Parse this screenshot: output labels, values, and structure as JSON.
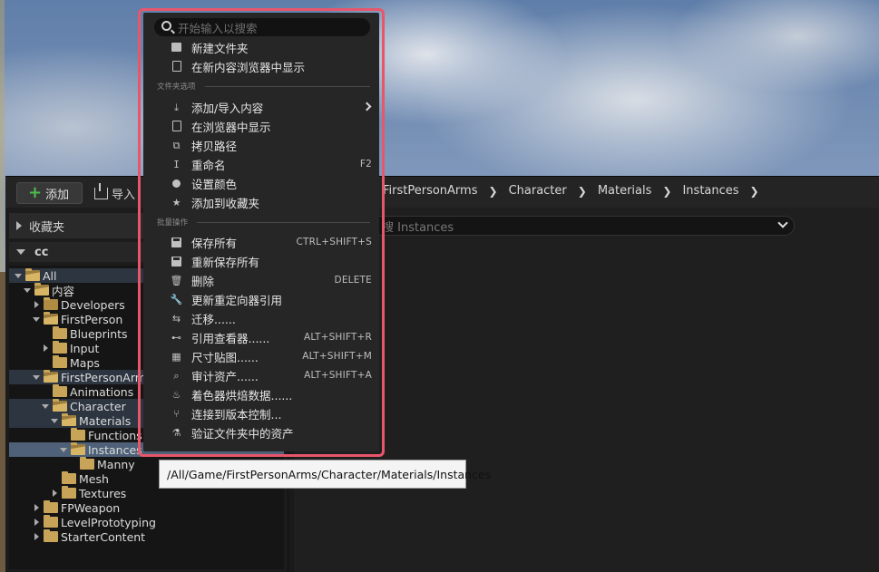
{
  "toolbar": {
    "add_label": "添加",
    "import_label": "导入"
  },
  "breadcrumb": [
    "FirstPersonArms",
    "Character",
    "Materials",
    "Instances"
  ],
  "search": {
    "placeholder": "搜 Instances"
  },
  "favorites": {
    "label": "收藏夹"
  },
  "collection": {
    "label": "cc"
  },
  "tree": [
    {
      "label": "All",
      "indent": 0,
      "arrow": "down",
      "folder": "open",
      "state": "hl"
    },
    {
      "label": "内容",
      "indent": 1,
      "arrow": "down",
      "folder": "open",
      "state": ""
    },
    {
      "label": "Developers",
      "indent": 2,
      "arrow": "right",
      "folder": "dev",
      "state": ""
    },
    {
      "label": "FirstPerson",
      "indent": 2,
      "arrow": "down",
      "folder": "open",
      "state": ""
    },
    {
      "label": "Blueprints",
      "indent": 3,
      "arrow": "none",
      "folder": "closed",
      "state": ""
    },
    {
      "label": "Input",
      "indent": 3,
      "arrow": "right",
      "folder": "closed",
      "state": ""
    },
    {
      "label": "Maps",
      "indent": 3,
      "arrow": "none",
      "folder": "closed",
      "state": ""
    },
    {
      "label": "FirstPersonArms",
      "indent": 2,
      "arrow": "down",
      "folder": "open",
      "state": "hl"
    },
    {
      "label": "Animations",
      "indent": 3,
      "arrow": "none",
      "folder": "closed",
      "state": ""
    },
    {
      "label": "Character",
      "indent": 3,
      "arrow": "down",
      "folder": "open",
      "state": "hl"
    },
    {
      "label": "Materials",
      "indent": 4,
      "arrow": "down",
      "folder": "open",
      "state": "hl"
    },
    {
      "label": "Functions",
      "indent": 5,
      "arrow": "none",
      "folder": "closed",
      "state": ""
    },
    {
      "label": "Instances",
      "indent": 5,
      "arrow": "down",
      "folder": "open",
      "state": "sel"
    },
    {
      "label": "Manny",
      "indent": 6,
      "arrow": "none",
      "folder": "closed",
      "state": ""
    },
    {
      "label": "Mesh",
      "indent": 4,
      "arrow": "none",
      "folder": "closed",
      "state": ""
    },
    {
      "label": "Textures",
      "indent": 4,
      "arrow": "right",
      "folder": "closed",
      "state": ""
    },
    {
      "label": "FPWeapon",
      "indent": 2,
      "arrow": "right",
      "folder": "closed",
      "state": ""
    },
    {
      "label": "LevelPrototyping",
      "indent": 2,
      "arrow": "right",
      "folder": "closed",
      "state": ""
    },
    {
      "label": "StarterContent",
      "indent": 2,
      "arrow": "right",
      "folder": "closed",
      "state": ""
    }
  ],
  "menu": {
    "search_placeholder": "开始输入以搜索",
    "section_folder": "文件夹选项",
    "section_bulk": "批量操作",
    "items": [
      {
        "label": "新建文件夹",
        "shortcut": "",
        "icon": "new-folder-icon",
        "sub": false
      },
      {
        "label": "在新内容浏览器中显示",
        "shortcut": "",
        "icon": "show-in-browser-icon",
        "sub": false
      },
      {
        "label": "添加/导入内容",
        "shortcut": "",
        "icon": "import-icon",
        "sub": true
      },
      {
        "label": "在浏览器中显示",
        "shortcut": "",
        "icon": "explore-icon",
        "sub": false
      },
      {
        "label": "拷贝路径",
        "shortcut": "",
        "icon": "copy-path-icon",
        "sub": false
      },
      {
        "label": "重命名",
        "shortcut": "F2",
        "icon": "rename-icon",
        "sub": false
      },
      {
        "label": "设置颜色",
        "shortcut": "",
        "icon": "color-icon",
        "sub": false
      },
      {
        "label": "添加到收藏夹",
        "shortcut": "",
        "icon": "star-icon",
        "sub": false
      },
      {
        "label": "保存所有",
        "shortcut": "CTRL+SHIFT+S",
        "icon": "save-icon",
        "sub": false
      },
      {
        "label": "重新保存所有",
        "shortcut": "",
        "icon": "resave-icon",
        "sub": false
      },
      {
        "label": "删除",
        "shortcut": "DELETE",
        "icon": "trash-icon",
        "sub": false
      },
      {
        "label": "更新重定向器引用",
        "shortcut": "",
        "icon": "wrench-icon",
        "sub": false
      },
      {
        "label": "迁移......",
        "shortcut": "",
        "icon": "migrate-icon",
        "sub": false
      },
      {
        "label": "引用查看器......",
        "shortcut": "ALT+SHIFT+R",
        "icon": "reference-viewer-icon",
        "sub": false
      },
      {
        "label": "尺寸贴图......",
        "shortcut": "ALT+SHIFT+M",
        "icon": "size-map-icon",
        "sub": false
      },
      {
        "label": "审计资产......",
        "shortcut": "ALT+SHIFT+A",
        "icon": "audit-icon",
        "sub": false
      },
      {
        "label": "着色器烘焙数据......",
        "shortcut": "",
        "icon": "shader-icon",
        "sub": false
      },
      {
        "label": "连接到版本控制...",
        "shortcut": "",
        "icon": "source-control-icon",
        "sub": false
      },
      {
        "label": "验证文件夹中的资产",
        "shortcut": "",
        "icon": "validate-icon",
        "sub": false
      }
    ]
  },
  "tooltip": {
    "text": "/All/Game/FirstPersonArms/Character/Materials/Instances"
  },
  "colors": {
    "menu_highlight_border": "#e8566c",
    "selection": "#4e6178",
    "folder": "#c8a458",
    "add_accent": "#4bbd4b"
  }
}
